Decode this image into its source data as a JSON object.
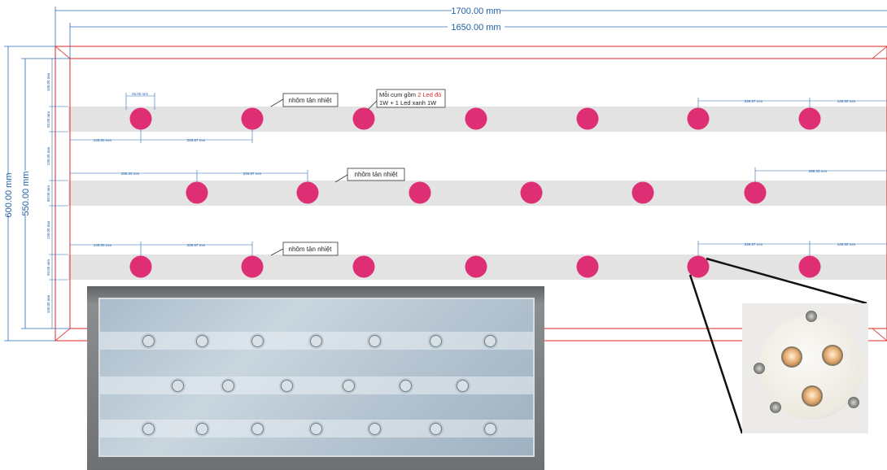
{
  "dimensions": {
    "outer_width": "1700.00 mm",
    "inner_width": "1650.00 mm",
    "outer_height": "600.00 mm",
    "inner_height": "550.00 mm"
  },
  "callouts": {
    "heat_sink": "nhôm tản nhiệt",
    "cluster_note_prefix": "Mỗi cụm gồm ",
    "cluster_note_red": "2 Led đỏ",
    "cluster_note_line2": "1W + 1 Led xanh 1W"
  },
  "small_dims": {
    "d45": "45.00 mm",
    "d145": "145.00 mm",
    "d22967": "229.67 mm",
    "d25833": "258.33 mm",
    "d22967b": "226.67 mm",
    "v100": "100.00 mm",
    "v50": "50.00 mm",
    "v13000": "130.00 mm",
    "v8000": "80.00 mm"
  },
  "colors": {
    "led": "#de2f74",
    "frame": "#e24a4a",
    "dimension": "#2a6db5",
    "strip": "#e3e3e3"
  },
  "layout_counts": {
    "row1_leds": 7,
    "row2_leds": 6,
    "row3_leds": 7
  }
}
